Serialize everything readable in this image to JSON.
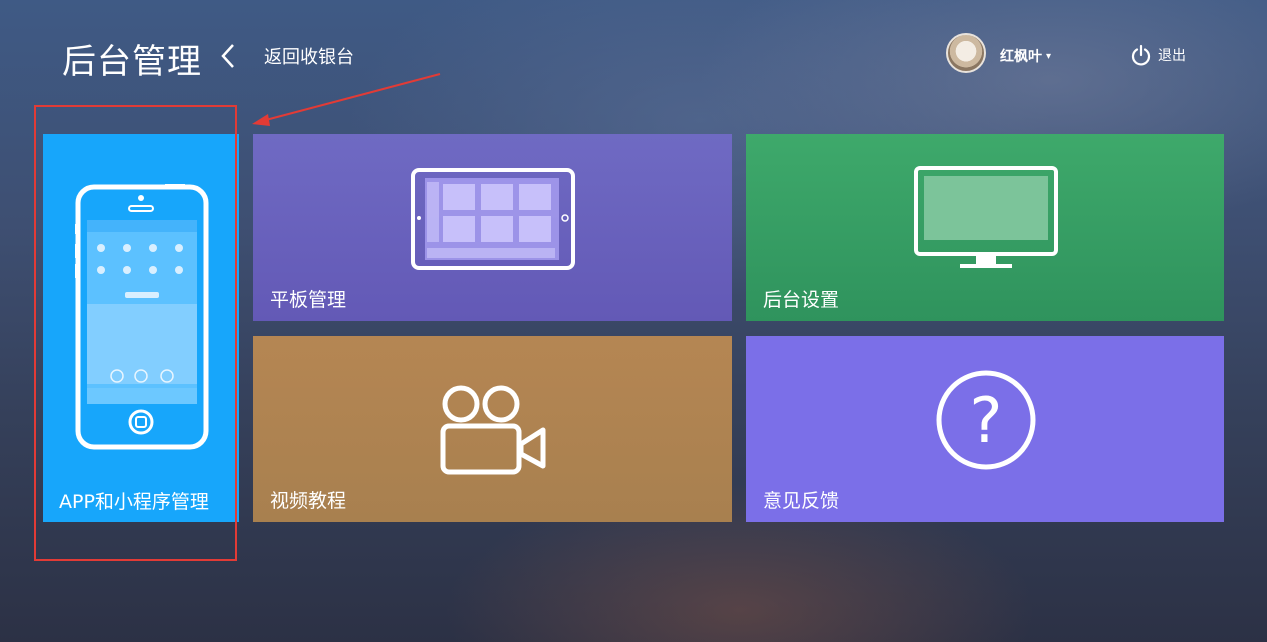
{
  "header": {
    "title": "后台管理",
    "back_label": "返回收银台",
    "username": "红枫叶",
    "logout_label": "退出"
  },
  "tiles": [
    {
      "label": "APP和小程序管理",
      "icon": "phone-icon",
      "color": "#17a6fb"
    },
    {
      "label": "平板管理",
      "icon": "tablet-icon",
      "color": "#6a63be"
    },
    {
      "label": "后台设置",
      "icon": "monitor-icon",
      "color": "#379f65"
    },
    {
      "label": "视频教程",
      "icon": "video-camera-icon",
      "color": "#b08452"
    },
    {
      "label": "意见反馈",
      "icon": "question-icon",
      "color": "#7b6fe8"
    }
  ],
  "annotation": {
    "color": "#e23b36"
  }
}
